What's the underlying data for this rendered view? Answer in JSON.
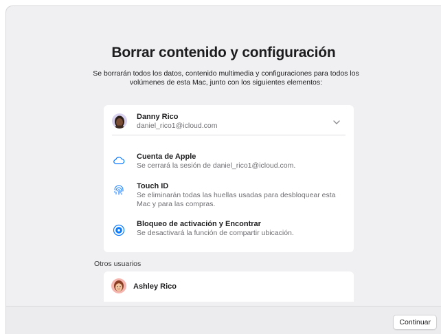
{
  "window": {
    "title": "Borrar contenido y configuración",
    "subtitle": "Se borrarán todos los datos, contenido multimedia y configuraciones para todos los volúmenes de esta Mac, junto con los siguientes elementos:"
  },
  "account": {
    "name": "Danny Rico",
    "email": "daniel_rico1@icloud.com",
    "avatar_icon": "memoji-avatar-icon",
    "chevron_icon": "chevron-down-icon"
  },
  "items": [
    {
      "icon": "cloud-icon",
      "title": "Cuenta de Apple",
      "description": "Se cerrará la sesión de daniel_rico1@icloud.com."
    },
    {
      "icon": "fingerprint-icon",
      "title": "Touch ID",
      "description": "Se eliminarán todas las huellas usadas para desbloquear esta Mac y para las compras."
    },
    {
      "icon": "find-my-icon",
      "title": "Bloqueo de activación y Encontrar",
      "description": "Se desactivará la función de compartir ubicación."
    }
  ],
  "other_users": {
    "label": "Otros usuarios",
    "users": [
      {
        "name": "Ashley Rico",
        "avatar_icon": "memoji-avatar-icon"
      }
    ]
  },
  "footer": {
    "continue_label": "Continuar"
  },
  "colors": {
    "window_bg": "#f0f0f2",
    "card_bg": "#ffffff",
    "accent_blue": "#0a7aff",
    "secondary_text": "#6e6e73"
  }
}
